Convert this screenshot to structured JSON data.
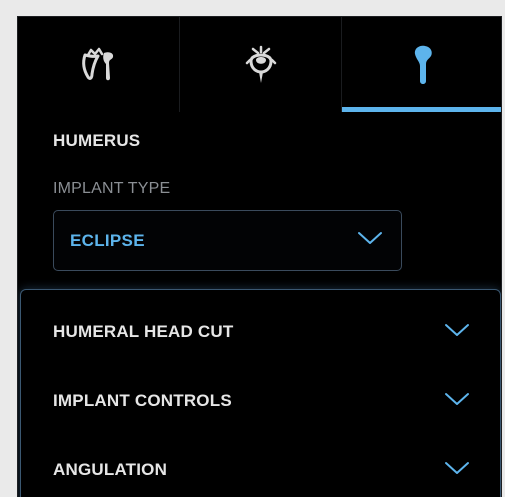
{
  "tabs": [
    {
      "icon": "scapula-glenoid-icon",
      "active": false
    },
    {
      "icon": "glenoid-component-icon",
      "active": false
    },
    {
      "icon": "humerus-icon",
      "active": true
    }
  ],
  "section": {
    "title": "HUMERUS"
  },
  "implant_type": {
    "label": "IMPLANT TYPE",
    "selected": "ECLIPSE"
  },
  "accordion": {
    "items": [
      {
        "label": "HUMERAL HEAD CUT"
      },
      {
        "label": "IMPLANT CONTROLS"
      },
      {
        "label": "ANGULATION"
      }
    ]
  },
  "colors": {
    "accent": "#5db4ec",
    "panel_background": "#000000",
    "page_background": "#eaeaea",
    "text_primary": "#e6e6e6",
    "text_muted": "#8b8f94",
    "icon_inactive": "#d9d9d9"
  }
}
